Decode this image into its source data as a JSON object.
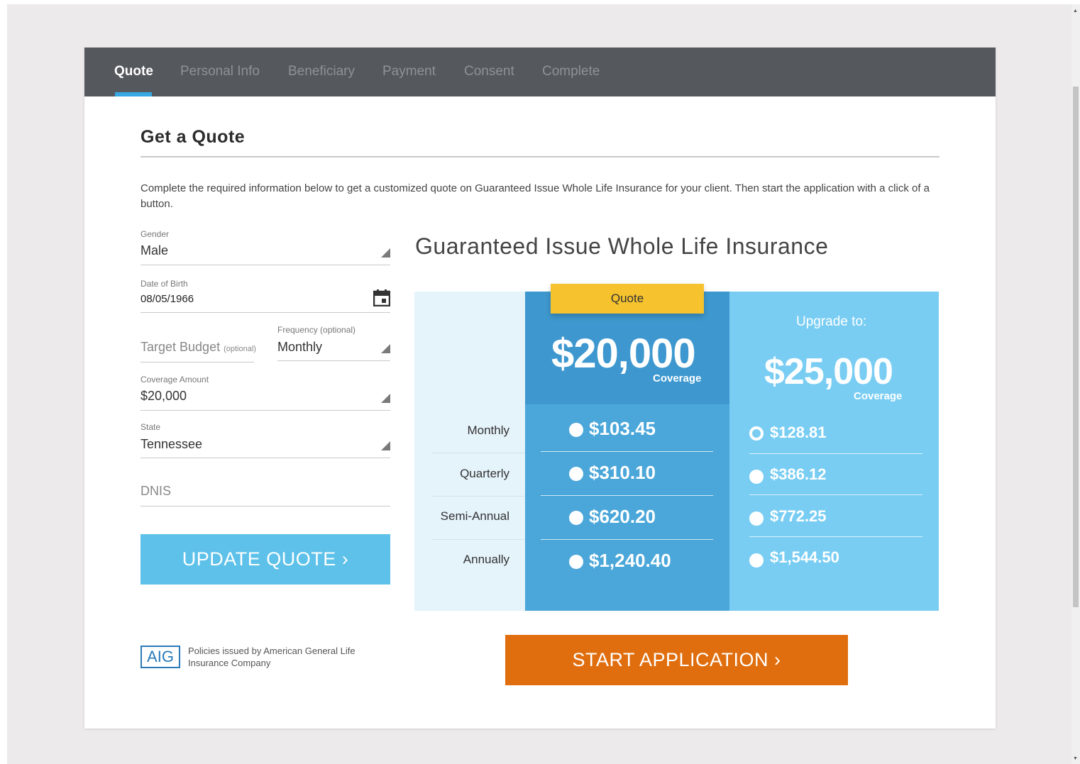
{
  "nav": {
    "tabs": [
      {
        "label": "Quote",
        "active": true
      },
      {
        "label": "Personal Info",
        "active": false
      },
      {
        "label": "Beneficiary",
        "active": false
      },
      {
        "label": "Payment",
        "active": false
      },
      {
        "label": "Consent",
        "active": false
      },
      {
        "label": "Complete",
        "active": false
      }
    ]
  },
  "page": {
    "title": "Get a Quote",
    "intro": "Complete the required information below to get a customized quote on Guaranteed Issue Whole Life Insurance for your client. Then start the application with a click of a button."
  },
  "form": {
    "gender": {
      "label": "Gender",
      "value": "Male"
    },
    "dob": {
      "label": "Date of Birth",
      "value": "08/05/1966"
    },
    "target_budget": {
      "placeholder": "Target Budget",
      "suffix": "(optional)"
    },
    "frequency": {
      "label": "Frequency (optional)",
      "value": "Monthly"
    },
    "coverage": {
      "label": "Coverage Amount",
      "value": "$20,000"
    },
    "state": {
      "label": "State",
      "value": "Tennessee"
    },
    "dnis": {
      "placeholder": "DNIS"
    },
    "update_button": "UPDATE QUOTE ›"
  },
  "footer": {
    "logo": "AIG",
    "text": "Policies issued by American General Life Insurance Company"
  },
  "quote_panel": {
    "title": "Guaranteed Issue Whole Life Insurance",
    "quote_tag": "Quote",
    "current_amount": "$20,000",
    "coverage_label": "Coverage",
    "upgrade_label": "Upgrade to:",
    "upgrade_amount": "$25,000",
    "rows": [
      {
        "label": "Monthly",
        "current": "$103.45",
        "upgrade": "$128.81"
      },
      {
        "label": "Quarterly",
        "current": "$310.10",
        "upgrade": "$386.12"
      },
      {
        "label": "Semi-Annual",
        "current": "$620.20",
        "upgrade": "$772.25"
      },
      {
        "label": "Annually",
        "current": "$1,240.40",
        "upgrade": "$1,544.50"
      }
    ],
    "start_button": "START APPLICATION ›"
  },
  "colors": {
    "nav_bg": "#55585d",
    "accent_blue": "#38a8e2",
    "update_button": "#5dc1e9",
    "quote_tag": "#f6c22e",
    "start_button": "#e06e0e"
  }
}
